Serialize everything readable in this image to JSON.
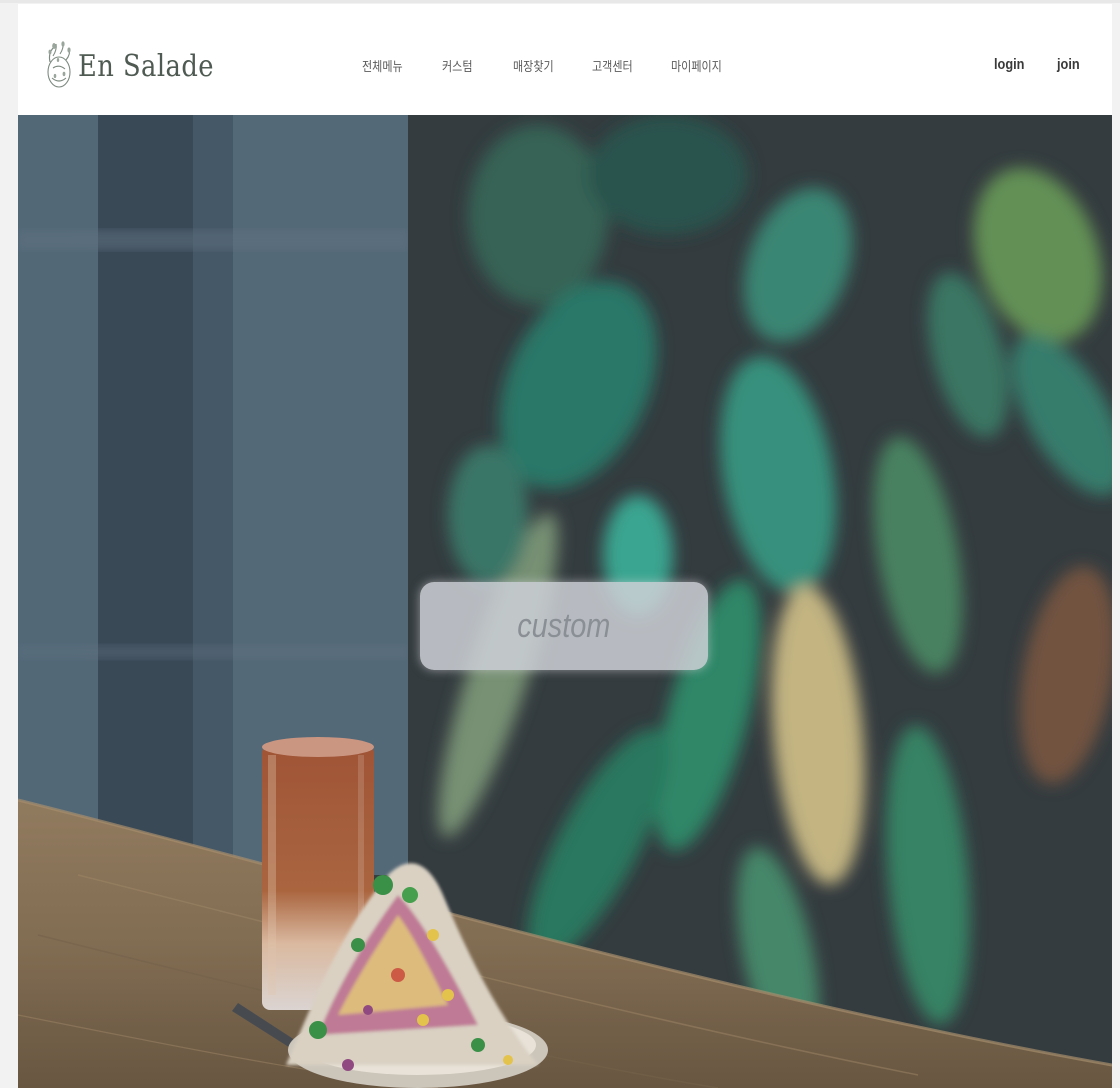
{
  "brand": {
    "name": "En Salade",
    "logo_icon": "leaf-wreath-icon",
    "text_color": "#4f5a52"
  },
  "nav": {
    "items": [
      {
        "label": "전체메뉴"
      },
      {
        "label": "커스텀"
      },
      {
        "label": "매장찾기"
      },
      {
        "label": "고객센터"
      },
      {
        "label": "마이페이지"
      }
    ]
  },
  "auth": {
    "login_label": "login",
    "join_label": "join"
  },
  "hero": {
    "button_label": "custom",
    "image_subject": "salad-and-iced-tea-on-wooden-table-with-plants"
  }
}
